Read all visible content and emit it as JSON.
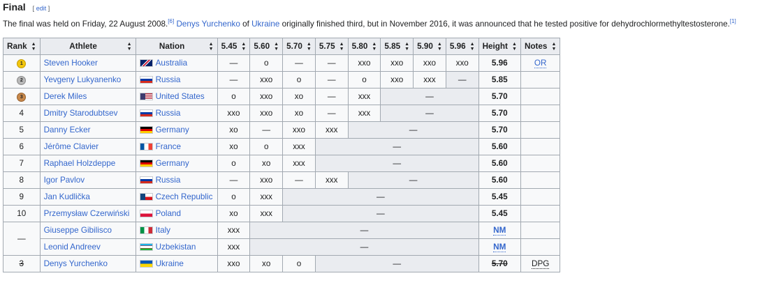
{
  "section": {
    "title": "Final",
    "edit_label": "edit"
  },
  "intro": {
    "pre": "The final was held on Friday, 22 August 2008.",
    "ref1": "[6]",
    "athlete_link": "Denys Yurchenko",
    "of": " of ",
    "nation_link": "Ukraine",
    "post": " originally finished third, but in November 2016, it was announced that he tested positive for dehydrochlormethyltestosterone.",
    "ref2": "[1]"
  },
  "table": {
    "headers": {
      "rank": "Rank",
      "athlete": "Athlete",
      "nation": "Nation",
      "heights": [
        "5.45",
        "5.60",
        "5.70",
        "5.75",
        "5.80",
        "5.85",
        "5.90",
        "5.96"
      ],
      "height": "Height",
      "notes": "Notes"
    },
    "rows": [
      {
        "rank": "1",
        "medal": "gold",
        "athlete": "Steven Hooker",
        "nation": "Australia",
        "flag": "australia",
        "cells": [
          {
            "v": "—",
            "span": 1
          },
          {
            "v": "o",
            "span": 1
          },
          {
            "v": "—",
            "span": 1
          },
          {
            "v": "—",
            "span": 1
          },
          {
            "v": "xxo",
            "span": 1
          },
          {
            "v": "xxo",
            "span": 1
          },
          {
            "v": "xxo",
            "span": 1
          },
          {
            "v": "xxo",
            "span": 1
          }
        ],
        "height": "5.96",
        "notes": "OR"
      },
      {
        "rank": "2",
        "medal": "silver",
        "athlete": "Yevgeny Lukyanenko",
        "nation": "Russia",
        "flag": "russia",
        "cells": [
          {
            "v": "—",
            "span": 1
          },
          {
            "v": "xxo",
            "span": 1
          },
          {
            "v": "o",
            "span": 1
          },
          {
            "v": "—",
            "span": 1
          },
          {
            "v": "o",
            "span": 1
          },
          {
            "v": "xxo",
            "span": 1
          },
          {
            "v": "xxx",
            "span": 1
          },
          {
            "v": "—",
            "span": 1,
            "shade": true
          }
        ],
        "height": "5.85",
        "notes": ""
      },
      {
        "rank": "3",
        "medal": "bronze",
        "athlete": "Derek Miles",
        "nation": "United States",
        "flag": "usa",
        "cells": [
          {
            "v": "o",
            "span": 1
          },
          {
            "v": "xxo",
            "span": 1
          },
          {
            "v": "xo",
            "span": 1
          },
          {
            "v": "—",
            "span": 1
          },
          {
            "v": "xxx",
            "span": 1
          },
          {
            "v": "—",
            "span": 3,
            "shade": true
          }
        ],
        "height": "5.70",
        "notes": ""
      },
      {
        "rank": "4",
        "athlete": "Dmitry Starodubtsev",
        "nation": "Russia",
        "flag": "russia",
        "cells": [
          {
            "v": "xxo",
            "span": 1
          },
          {
            "v": "xxo",
            "span": 1
          },
          {
            "v": "xo",
            "span": 1
          },
          {
            "v": "—",
            "span": 1
          },
          {
            "v": "xxx",
            "span": 1
          },
          {
            "v": "—",
            "span": 3,
            "shade": true
          }
        ],
        "height": "5.70",
        "notes": ""
      },
      {
        "rank": "5",
        "athlete": "Danny Ecker",
        "nation": "Germany",
        "flag": "germany",
        "cells": [
          {
            "v": "xo",
            "span": 1
          },
          {
            "v": "—",
            "span": 1
          },
          {
            "v": "xxo",
            "span": 1
          },
          {
            "v": "xxx",
            "span": 1
          },
          {
            "v": "—",
            "span": 4,
            "shade": true
          }
        ],
        "height": "5.70",
        "notes": ""
      },
      {
        "rank": "6",
        "athlete": "Jérôme Clavier",
        "nation": "France",
        "flag": "france",
        "cells": [
          {
            "v": "xo",
            "span": 1
          },
          {
            "v": "o",
            "span": 1
          },
          {
            "v": "xxx",
            "span": 1
          },
          {
            "v": "—",
            "span": 5,
            "shade": true
          }
        ],
        "height": "5.60",
        "notes": ""
      },
      {
        "rank": "7",
        "athlete": "Raphael Holzdeppe",
        "nation": "Germany",
        "flag": "germany",
        "cells": [
          {
            "v": "o",
            "span": 1
          },
          {
            "v": "xo",
            "span": 1
          },
          {
            "v": "xxx",
            "span": 1
          },
          {
            "v": "—",
            "span": 5,
            "shade": true
          }
        ],
        "height": "5.60",
        "notes": ""
      },
      {
        "rank": "8",
        "athlete": "Igor Pavlov",
        "nation": "Russia",
        "flag": "russia",
        "cells": [
          {
            "v": "—",
            "span": 1
          },
          {
            "v": "xxo",
            "span": 1
          },
          {
            "v": "—",
            "span": 1
          },
          {
            "v": "xxx",
            "span": 1
          },
          {
            "v": "—",
            "span": 4,
            "shade": true
          }
        ],
        "height": "5.60",
        "notes": ""
      },
      {
        "rank": "9",
        "athlete": "Jan Kudlička",
        "nation": "Czech Republic",
        "flag": "czech",
        "cells": [
          {
            "v": "o",
            "span": 1
          },
          {
            "v": "xxx",
            "span": 1
          },
          {
            "v": "—",
            "span": 6,
            "shade": true
          }
        ],
        "height": "5.45",
        "notes": ""
      },
      {
        "rank": "10",
        "athlete": "Przemysław Czerwiński",
        "nation": "Poland",
        "flag": "poland",
        "cells": [
          {
            "v": "xo",
            "span": 1
          },
          {
            "v": "xxx",
            "span": 1
          },
          {
            "v": "—",
            "span": 6,
            "shade": true
          }
        ],
        "height": "5.45",
        "notes": ""
      },
      {
        "rank": "—",
        "rankspan": 2,
        "athlete": "Giuseppe Gibilisco",
        "nation": "Italy",
        "flag": "italy",
        "cells": [
          {
            "v": "xxx",
            "span": 1
          },
          {
            "v": "—",
            "span": 7,
            "shade": true
          }
        ],
        "height": "NM",
        "height_nm": true,
        "notes": ""
      },
      {
        "rank_skip": true,
        "athlete": "Leonid Andreev",
        "nation": "Uzbekistan",
        "flag": "uzbekistan",
        "cells": [
          {
            "v": "xxx",
            "span": 1
          },
          {
            "v": "—",
            "span": 7,
            "shade": true
          }
        ],
        "height": "NM",
        "height_nm": true,
        "notes": ""
      },
      {
        "rank": "3",
        "rank_strike": true,
        "athlete": "Denys Yurchenko",
        "nation": "Ukraine",
        "flag": "ukraine",
        "cells": [
          {
            "v": "xxo",
            "span": 1
          },
          {
            "v": "xo",
            "span": 1
          },
          {
            "v": "o",
            "span": 1
          },
          {
            "v": "—",
            "span": 5,
            "shade": true
          }
        ],
        "height": "5.70",
        "height_strike": true,
        "notes": "DPG",
        "notes_plain": true
      }
    ]
  },
  "colors": {
    "link": "#3366cc",
    "header_bg": "#eaecf0",
    "border": "#a2a9b1",
    "table_bg": "#f8f9fa"
  }
}
